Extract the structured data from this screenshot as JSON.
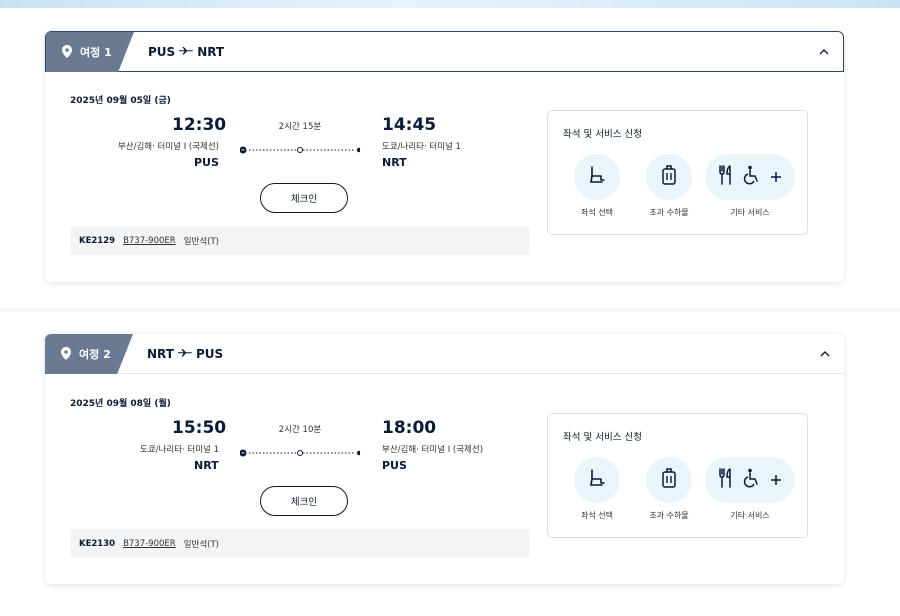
{
  "journeys": [
    {
      "tag": "여정 1",
      "route_from": "PUS",
      "route_to": "NRT",
      "date": "2025년 09월 05일 (금)",
      "dep_time": "12:30",
      "dep_terminal": "부산/김해· 터미널 I (국제선)",
      "dep_code": "PUS",
      "duration": "2시간 15분",
      "arr_time": "14:45",
      "arr_terminal": "도쿄/나리타· 터미널 1",
      "arr_code": "NRT",
      "checkin_label": "체크인",
      "flight_no": "KE2129",
      "aircraft": "B737-900ER",
      "cabin": "일반석(T)"
    },
    {
      "tag": "여정 2",
      "route_from": "NRT",
      "route_to": "PUS",
      "date": "2025년 09월 08일 (월)",
      "dep_time": "15:50",
      "dep_terminal": "도쿄/나리타· 터미널 1",
      "dep_code": "NRT",
      "duration": "2시간 10분",
      "arr_time": "18:00",
      "arr_terminal": "부산/김해· 터미널 I (국제선)",
      "arr_code": "PUS",
      "checkin_label": "체크인",
      "flight_no": "KE2130",
      "aircraft": "B737-900ER",
      "cabin": "일반석(T)"
    }
  ],
  "services": {
    "title": "좌석 및 서비스 신청",
    "seat_label": "좌석 선택",
    "baggage_label": "초과 수하물",
    "other_label": "기타 서비스"
  },
  "icons": [
    "pin-icon",
    "plane-icon",
    "chevron-up-icon",
    "seat-icon",
    "baggage-icon",
    "meal-icon",
    "wheelchair-icon",
    "plus-icon"
  ],
  "colors": {
    "navy": "#0b1a36",
    "tag_gray": "#6b7a93",
    "service_bg": "#eaf4fb"
  }
}
